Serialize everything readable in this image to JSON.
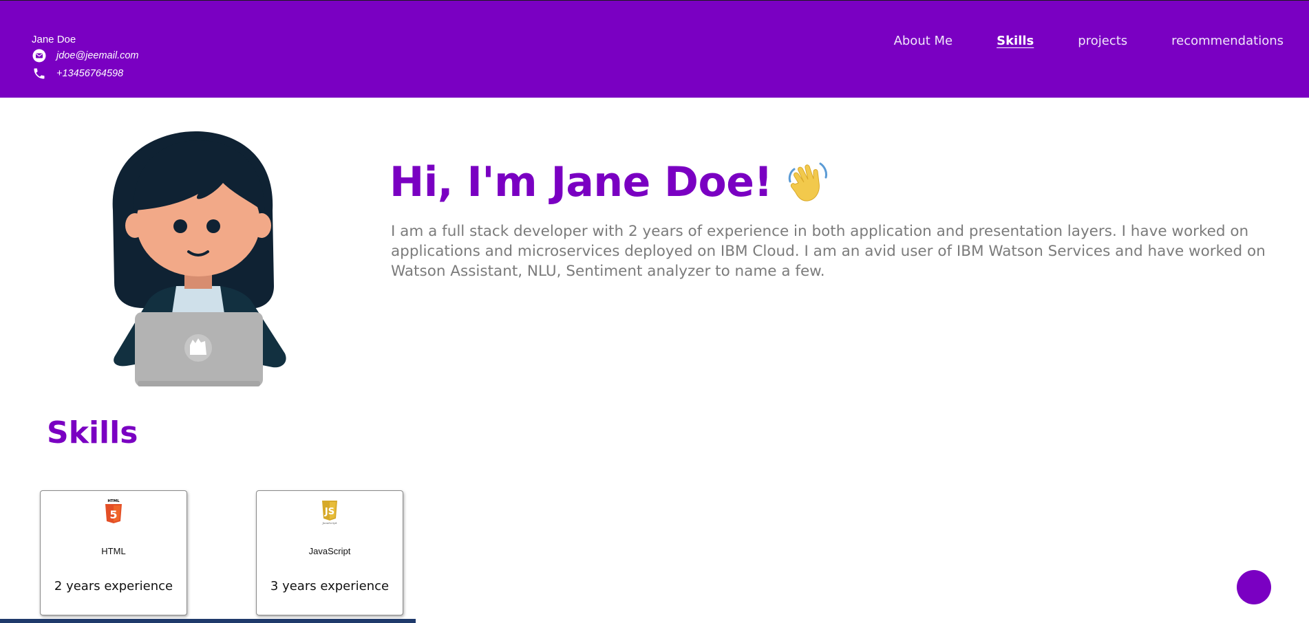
{
  "header": {
    "name": "Jane Doe",
    "email": "jdoe@jeemail.com",
    "phone": "+13456764598",
    "email_icon": "mail-icon",
    "phone_icon": "phone-icon",
    "nav": [
      {
        "label": "About Me",
        "active": false
      },
      {
        "label": "Skills",
        "active": true
      },
      {
        "label": "projects",
        "active": false
      },
      {
        "label": "recommendations",
        "active": false
      }
    ]
  },
  "intro": {
    "title": "Hi, I'm Jane Doe!",
    "wave_icon": "waving-hand-icon",
    "text": "I am a full stack developer with 2 years of experience in both application and presentation layers. I have worked on applications and microservices deployed on IBM Cloud. I am an avid user of IBM Watson Services and have worked on Watson Assistant, NLU, Sentiment analyzer to name a few."
  },
  "skills": {
    "title": "Skills",
    "cards": [
      {
        "name": "HTML",
        "experience": "2 years experience",
        "icon": "html5-logo-icon"
      },
      {
        "name": "JavaScript",
        "experience": "3 years experience",
        "icon": "javascript-logo-icon"
      }
    ]
  },
  "colors": {
    "primary": "#7a00c2",
    "text_gray": "#7b7b7b",
    "hair": "#0f2233",
    "skin": "#f2a988",
    "laptop": "#b3b3b3"
  }
}
